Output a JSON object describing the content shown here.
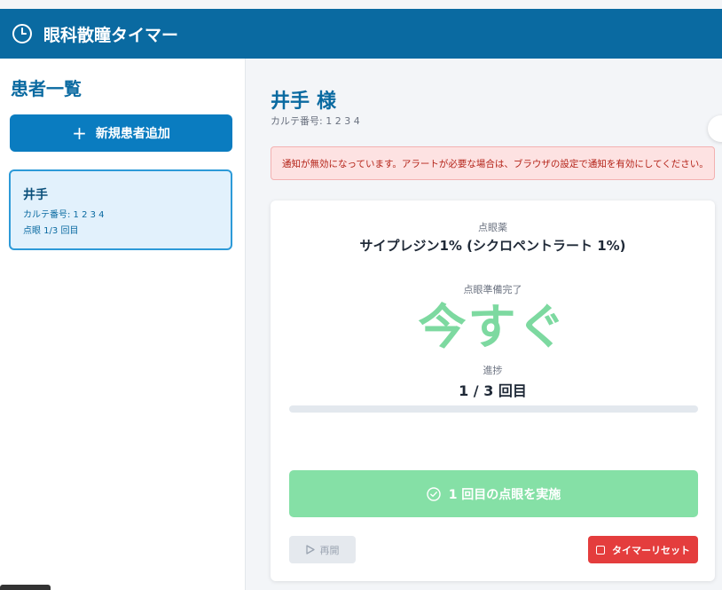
{
  "header": {
    "title": "眼科散瞳タイマー",
    "icon": "clock-icon",
    "color": "#0a6aa1"
  },
  "sidebar": {
    "heading": "患者一覧",
    "add_button": {
      "icon": "plus-icon",
      "label": "新規患者追加"
    },
    "patients": [
      {
        "name": "井手",
        "chart": "カルテ番号: 1 2 3 4",
        "status": "点眼 1/3 回目"
      }
    ]
  },
  "main": {
    "patient_name": "井手",
    "suffix": "様",
    "chart": "カルテ番号: 1 2 3 4",
    "alert": "通知が無効になっています。アラートが必要な場合は、ブラウザの設定で通知を有効にしてください。",
    "card": {
      "drug_label": "点眼薬",
      "drug_name": "サイプレジン1% (シクロペントラート 1%)",
      "ready_label": "点眼準備完了",
      "countdown": "今すぐ",
      "progress_label": "進捗",
      "progress_value": "1 / 3 回目",
      "progress_fraction": 0,
      "action_button": "1 回目の点眼を実施",
      "resume_button": "再開",
      "reset_button": "タイマーリセット"
    }
  },
  "colors": {
    "accent": "#0a7cc0",
    "ready_green": "#7dd9a0",
    "danger": "#e43d3d",
    "alert_bg": "#fde2e2"
  }
}
